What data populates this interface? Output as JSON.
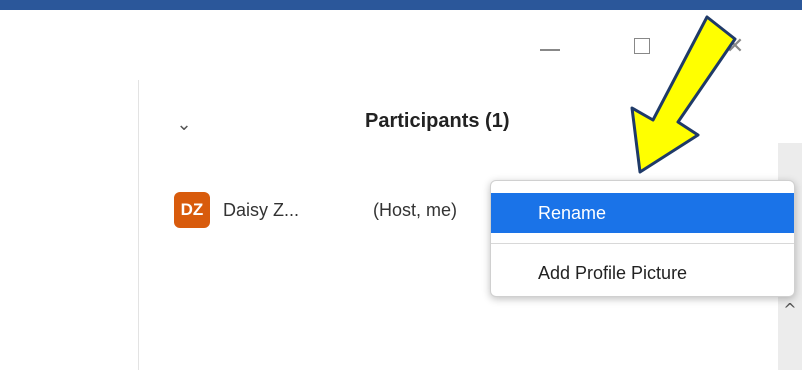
{
  "window": {
    "controls": {
      "minimize_icon": "minimize-icon",
      "maximize_icon": "maximize-icon",
      "close_icon": "close-icon"
    }
  },
  "participants_panel": {
    "title": "Participants (1)",
    "collapse_icon": "chevron-down-icon",
    "participants": [
      {
        "initials": "DZ",
        "name": "Daisy Z...",
        "role": "(Host, me)",
        "avatar_color": "#d85b0c"
      }
    ]
  },
  "context_menu": {
    "items": [
      {
        "label": "Rename",
        "highlighted": true
      },
      {
        "label": "Add Profile Picture",
        "highlighted": false
      }
    ],
    "highlight_color": "#1a73e8"
  },
  "annotation": {
    "arrow_icon": "yellow-arrow-icon",
    "arrow_color": "#ffff00"
  },
  "scrollbar": {
    "up_icon": "chevron-up-icon"
  },
  "colors": {
    "top_band": "#2b579a"
  }
}
